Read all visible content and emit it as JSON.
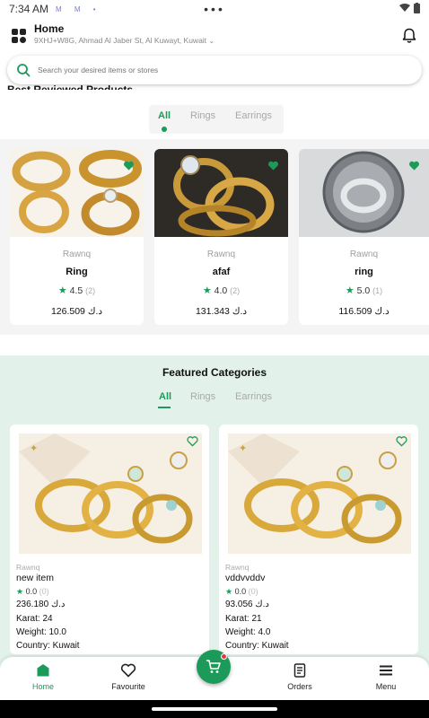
{
  "status_bar": {
    "time": "7:34 AM",
    "notif_icons": "M M •",
    "camera": "•••"
  },
  "header": {
    "title": "Home",
    "address": "9XHJ+W8G, Ahmad Al Jaber St, Al Kuwayt, Kuwait",
    "menu_icon": "grid-icon",
    "bell_icon": "bell-icon"
  },
  "search": {
    "placeholder": "Search your desired items or stores"
  },
  "best_reviewed": {
    "title": "Best Reviewed Products",
    "tabs": [
      {
        "label": "All",
        "active": true
      },
      {
        "label": "Rings",
        "active": false
      },
      {
        "label": "Earrings",
        "active": false
      }
    ],
    "products": [
      {
        "brand": "Rawnq",
        "name": "Ring",
        "rating": "4.5",
        "reviews": "(2)",
        "price": "126.509 د.ك"
      },
      {
        "brand": "Rawnq",
        "name": "afaf",
        "rating": "4.0",
        "reviews": "(2)",
        "price": "131.343 د.ك"
      },
      {
        "brand": "Rawnq",
        "name": "ring",
        "rating": "5.0",
        "reviews": "(1)",
        "price": "116.509 د.ك"
      }
    ]
  },
  "featured": {
    "title": "Featured Categories",
    "tabs": [
      {
        "label": "All",
        "active": true
      },
      {
        "label": "Rings",
        "active": false
      },
      {
        "label": "Earrings",
        "active": false
      }
    ],
    "items": [
      {
        "brand": "Rawnq",
        "name": "new item",
        "rating": "0.0",
        "reviews": "(0)",
        "price": "236.180 د.ك",
        "karat": "Karat: 24",
        "weight": "Weight: 10.0",
        "country": "Country: Kuwait"
      },
      {
        "brand": "Rawnq",
        "name": "vddvvddv",
        "rating": "0.0",
        "reviews": "(0)",
        "price": "93.056 د.ك",
        "karat": "Karat: 21",
        "weight": "Weight: 4.0",
        "country": "Country: Kuwait"
      }
    ]
  },
  "bottom_nav": {
    "items": [
      {
        "label": "Home",
        "icon": "home-icon",
        "active": true
      },
      {
        "label": "Favourite",
        "icon": "heart-icon",
        "active": false
      },
      {
        "label": "Orders",
        "icon": "orders-icon",
        "active": false
      },
      {
        "label": "Menu",
        "icon": "menu-icon",
        "active": false
      }
    ],
    "cart_icon": "cart-icon"
  },
  "colors": {
    "accent": "#1c9a5a",
    "featured_bg": "#e2f1ea",
    "badge": "#e53935"
  }
}
